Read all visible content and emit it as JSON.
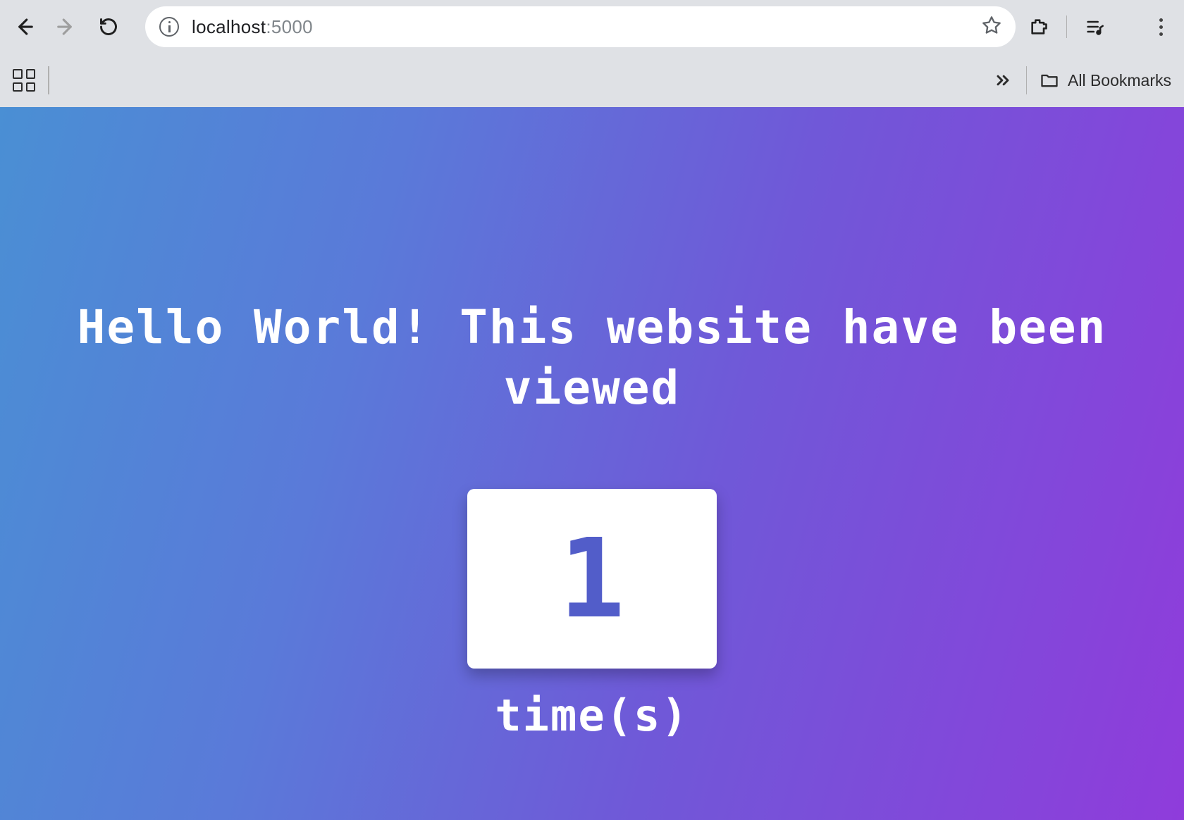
{
  "browser": {
    "url_host": "localhost",
    "url_port": ":5000",
    "bookmarks_label": "All Bookmarks"
  },
  "page": {
    "heading": "Hello World! This website have been viewed",
    "count": "1",
    "times_label": "time(s)"
  }
}
